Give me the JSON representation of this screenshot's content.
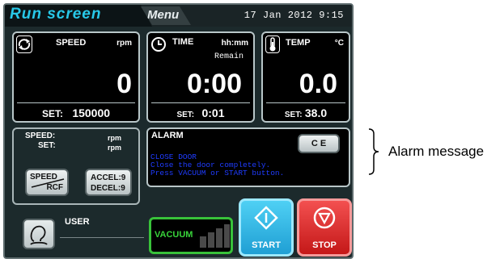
{
  "header": {
    "run_tab": "Run screen",
    "menu_tab": "Menu",
    "datetime": "17  Jan 2012   9:15"
  },
  "speed": {
    "title": "SPEED",
    "unit": "rpm",
    "value": "0",
    "set_label": "SET:",
    "set_value": "150000"
  },
  "time": {
    "title": "TIME",
    "unit": "hh:mm",
    "sublabel": "Remain",
    "value": "0:00",
    "set_label": "SET:",
    "set_value": "0:01"
  },
  "temp": {
    "title": "TEMP",
    "unit": "°C",
    "value": "0.0",
    "set_label": "SET:",
    "set_value": "38.0"
  },
  "speed_info": {
    "speed_label": "SPEED:",
    "speed_unit": "rpm",
    "set_label": "SET:",
    "set_unit": "rpm"
  },
  "buttons": {
    "speed_rcf_top": "SPEED",
    "speed_rcf_bottom": "RCF",
    "accel": "ACCEL:9",
    "decel": "DECEL:9",
    "ce": "C E",
    "vacuum": "VACUUM",
    "start": "START",
    "stop": "STOP"
  },
  "alarm": {
    "title": "ALARM",
    "lines": [
      "CLOSE DOOR",
      "Close the door completely.",
      "Press VACUUM or START button."
    ]
  },
  "user": {
    "label": "USER"
  },
  "annotation": {
    "text": "Alarm message"
  },
  "colors": {
    "accent": "#28c8e8",
    "alarm_text": "#1f3cff",
    "vacuum": "#38c23a",
    "start": "#1f9fd4",
    "stop": "#d62020"
  }
}
